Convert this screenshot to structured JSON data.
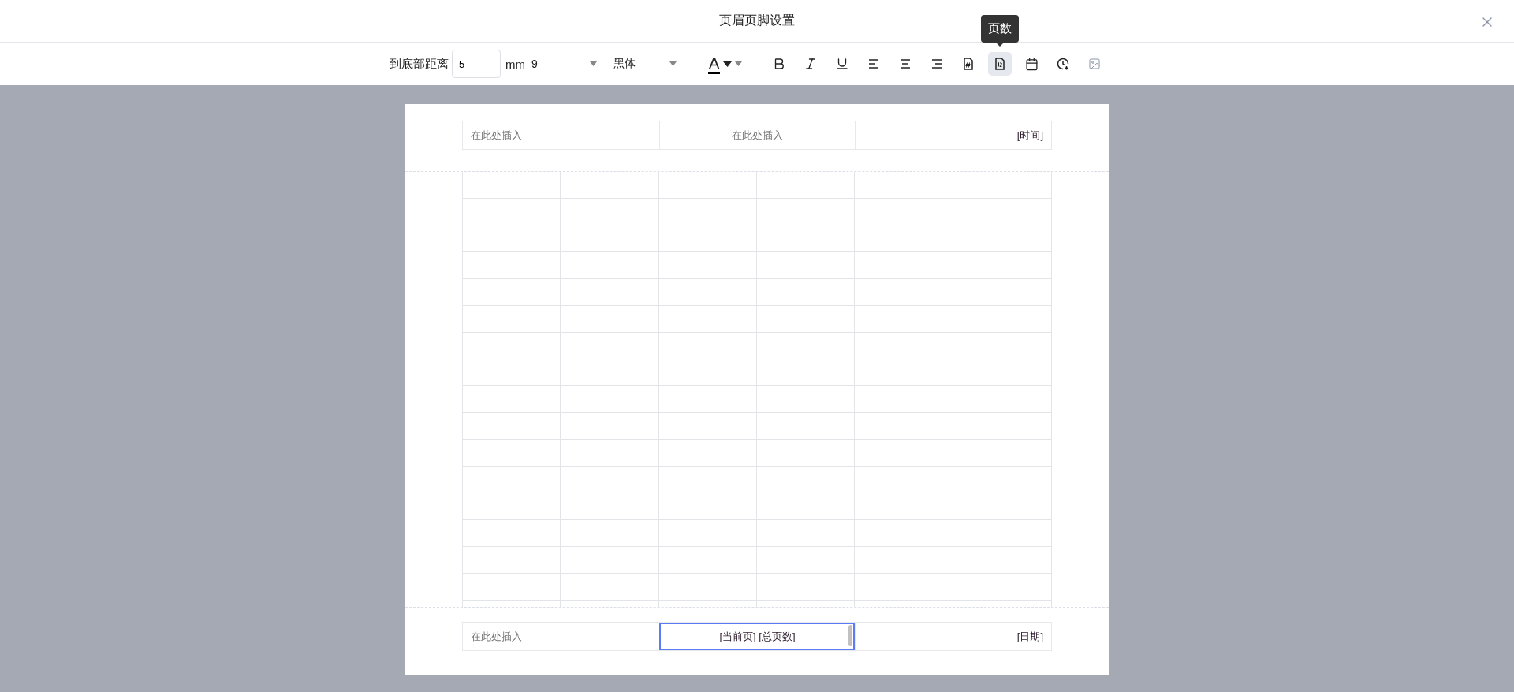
{
  "dialog": {
    "title": "页眉页脚设置"
  },
  "toolbar": {
    "distance_label": "到底部距离",
    "distance_value": "5",
    "unit": "mm",
    "font_size": "9",
    "font_family": "黑体",
    "font_color": {
      "label": "A",
      "color": "#000000"
    },
    "tools": [
      {
        "kind": "bold",
        "selected": false
      },
      {
        "kind": "italic",
        "selected": false
      },
      {
        "kind": "underline",
        "selected": false
      },
      {
        "kind": "align-left",
        "selected": false
      },
      {
        "kind": "align-center",
        "selected": false
      },
      {
        "kind": "align-right",
        "selected": false
      },
      {
        "kind": "page-number",
        "selected": false
      },
      {
        "kind": "page-count",
        "selected": true,
        "tooltip": "页数"
      },
      {
        "kind": "date",
        "selected": false
      },
      {
        "kind": "time",
        "selected": false
      },
      {
        "kind": "image",
        "selected": false
      }
    ]
  },
  "header": [
    {
      "text": "在此处插入",
      "kind": "placeholder",
      "focused": false
    },
    {
      "text": "在此处插入",
      "kind": "placeholder",
      "focused": false
    },
    {
      "text": "[时间]",
      "kind": "field",
      "focused": false
    }
  ],
  "footer": [
    {
      "text": "在此处插入",
      "kind": "placeholder",
      "focused": false
    },
    {
      "text": "[当前页] [总页数]",
      "kind": "field",
      "focused": true
    },
    {
      "text": "[日期]",
      "kind": "field",
      "focused": false
    }
  ]
}
